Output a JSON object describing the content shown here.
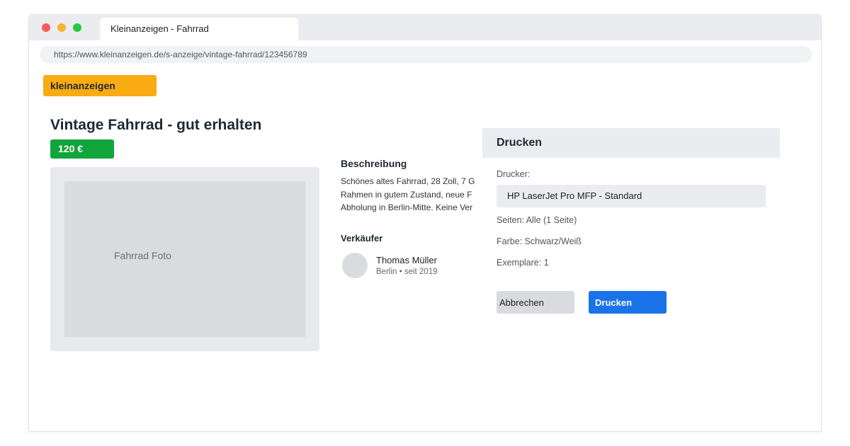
{
  "browser": {
    "tab_title": "Kleinanzeigen - Fahrrad",
    "url": "https://www.kleinanzeigen.de/s-anzeige/vintage-fahrrad/123456789"
  },
  "site": {
    "logo_text": "kleinanzeigen",
    "logo_color": "#f8ac12"
  },
  "listing": {
    "title": "Vintage Fahrrad - gut erhalten",
    "price": "120 €",
    "price_color": "#11a53c",
    "photo_label": "Fahrrad Foto",
    "description_heading": "Beschreibung",
    "description_lines": [
      "Schönes altes Fahrrad, 28 Zoll, 7 G",
      "Rahmen in gutem Zustand, neue F",
      "Abholung in Berlin-Mitte. Keine Ver"
    ]
  },
  "seller": {
    "heading": "Verkäufer",
    "name": "Thomas Müller",
    "meta": "Berlin • seit 2019"
  },
  "print_dialog": {
    "title": "Drucken",
    "printer_label": "Drucker:",
    "printer_value": "HP LaserJet Pro MFP - Standard",
    "pages": "Seiten: Alle (1 Seite)",
    "color": "Farbe: Schwarz/Weiß",
    "copies": "Exemplare: 1",
    "cancel_label": "Abbrechen",
    "print_label": "Drucken",
    "print_button_color": "#1a73e8"
  }
}
